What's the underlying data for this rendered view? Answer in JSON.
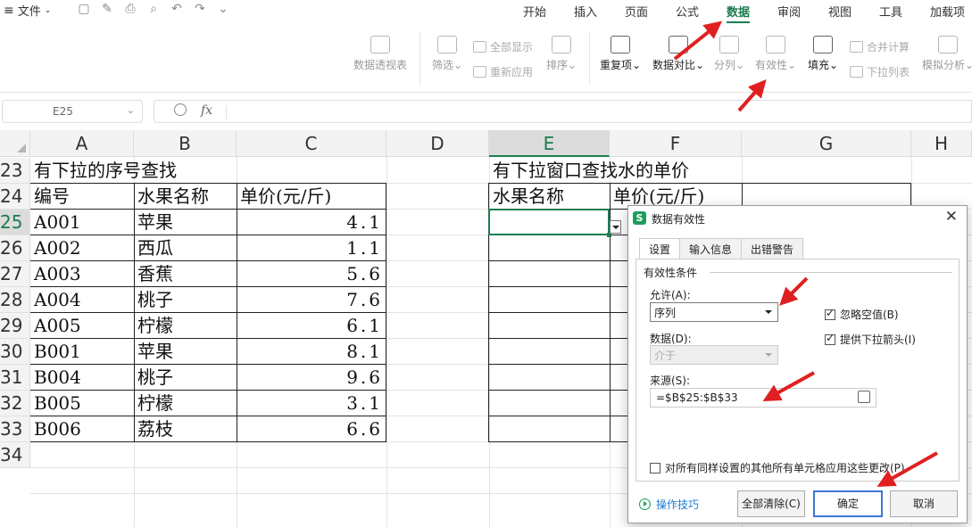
{
  "menu": {
    "file_label": "文件",
    "tabs": [
      "开始",
      "插入",
      "页面",
      "公式",
      "数据",
      "审阅",
      "视图",
      "工具",
      "加载项"
    ],
    "active_tab": "数据"
  },
  "ribbon": {
    "pivot": "数据透视表",
    "filter": "筛选",
    "show_all": "全部显示",
    "reapply": "重新应用",
    "sort": "排序",
    "duplicates": "重复项",
    "compare": "数据对比",
    "split": "分列",
    "validity": "有效性",
    "fill": "填充",
    "consolidate": "合并计算",
    "dropdown_list": "下拉列表",
    "simulation": "模拟分析"
  },
  "formula_bar": {
    "name_box": "E25",
    "fx": "fx",
    "content": ""
  },
  "columns": [
    "A",
    "B",
    "C",
    "D",
    "E",
    "F",
    "G",
    "H"
  ],
  "selected_column": "E",
  "rows": [
    "23",
    "24",
    "25",
    "26",
    "27",
    "28",
    "29",
    "30",
    "31",
    "32",
    "33",
    "34"
  ],
  "selected_row": "25",
  "sheet": {
    "left_title": "有下拉的序号查找",
    "left_headers": [
      "编号",
      "水果名称",
      "单价(元/斤)"
    ],
    "left_rows": [
      [
        "A001",
        "苹果",
        "4.1"
      ],
      [
        "A002",
        "西瓜",
        "1.1"
      ],
      [
        "A003",
        "香蕉",
        "5.6"
      ],
      [
        "A004",
        "桃子",
        "7.6"
      ],
      [
        "A005",
        "柠檬",
        "6.1"
      ],
      [
        "B001",
        "苹果",
        "8.1"
      ],
      [
        "B004",
        "桃子",
        "9.6"
      ],
      [
        "B005",
        "柠檬",
        "3.1"
      ],
      [
        "B006",
        "荔枝",
        "6.6"
      ]
    ],
    "right_title": "有下拉窗口查找水的单价",
    "right_headers": [
      "水果名称",
      "单价(元/斤)"
    ]
  },
  "dialog": {
    "title": "数据有效性",
    "close": "✕",
    "tabs": [
      "设置",
      "输入信息",
      "出错警告"
    ],
    "group_title": "有效性条件",
    "allow_label": "允许(A):",
    "allow_value": "序列",
    "data_label": "数据(D):",
    "data_value": "介于",
    "ignore_blank": "忽略空值(B)",
    "provide_dropdown": "提供下拉箭头(I)",
    "source_label": "来源(S):",
    "source_value": "=$B$25:$B$33",
    "apply_all": "对所有同样设置的其他所有单元格应用这些更改(P)",
    "tips": "操作技巧",
    "clear_all": "全部清除(C)",
    "ok": "确定",
    "cancel": "取消"
  },
  "colors": {
    "accent_green": "#1e7b50",
    "annotation_red": "#e02020",
    "link_blue": "#1e7bd0"
  }
}
